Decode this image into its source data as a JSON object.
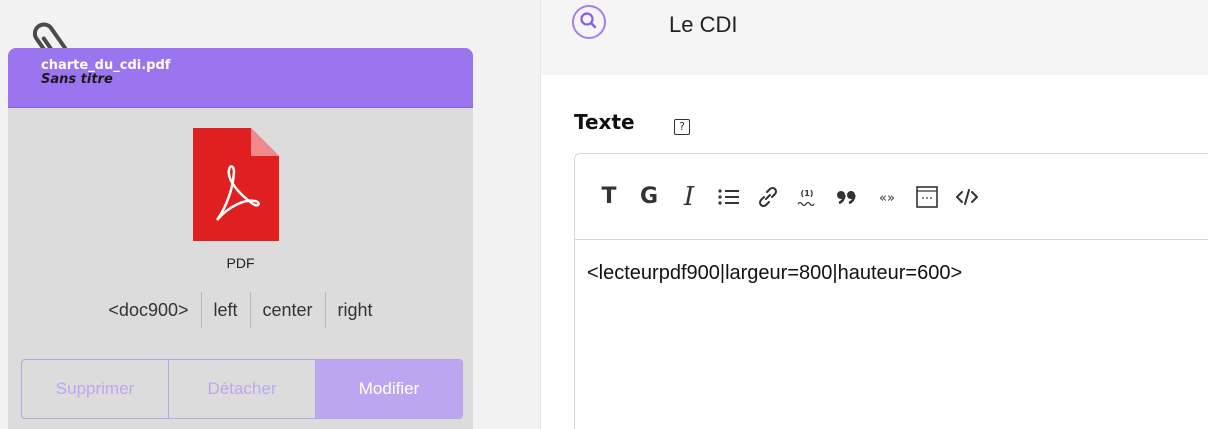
{
  "document_card": {
    "filename": "charte_du_cdi.pdf",
    "subtitle": "Sans titre",
    "file_type": "PDF",
    "shortcut": "<doc900>",
    "align_options": [
      "left",
      "center",
      "right"
    ],
    "actions": {
      "delete": "Supprimer",
      "detach": "Détacher",
      "edit": "Modifier"
    },
    "colors": {
      "header": "#9b75f0",
      "accent": "#bca6f0",
      "pdf_red": "#e02020"
    }
  },
  "title_field": {
    "value": "Le CDI",
    "icon": "search-icon"
  },
  "text_field": {
    "label": "Texte",
    "help": "?",
    "toolbar": [
      {
        "name": "heading-icon",
        "glyph": "T"
      },
      {
        "name": "bold-icon",
        "glyph": "G"
      },
      {
        "name": "italic-icon",
        "glyph": "I"
      },
      {
        "name": "bullet-list-icon",
        "glyph": "list"
      },
      {
        "name": "link-icon",
        "glyph": "link"
      },
      {
        "name": "footnote-icon",
        "glyph": "(1)"
      },
      {
        "name": "quote-icon",
        "glyph": "❞"
      },
      {
        "name": "guillemets-icon",
        "glyph": "«»"
      },
      {
        "name": "block-icon",
        "glyph": "box"
      },
      {
        "name": "code-icon",
        "glyph": "</>"
      }
    ],
    "content": "<lecteurpdf900|largeur=800|hauteur=600>"
  }
}
